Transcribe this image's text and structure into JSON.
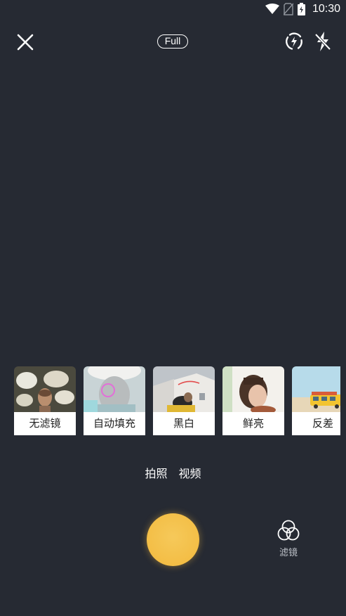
{
  "status_bar": {
    "time": "10:30",
    "icons": [
      "wifi-icon",
      "no-sim-icon",
      "battery-icon"
    ]
  },
  "toolbar": {
    "close_icon": "close-icon",
    "aspect_label": "Full",
    "switch_camera_icon": "switch-camera-icon",
    "flash_icon": "flash-off-icon"
  },
  "filters": [
    {
      "label": "无滤镜"
    },
    {
      "label": "自动填充"
    },
    {
      "label": "黑白"
    },
    {
      "label": "鲜亮"
    },
    {
      "label": "反差"
    }
  ],
  "modes": [
    {
      "label": "拍照"
    },
    {
      "label": "视频"
    }
  ],
  "filter_toggle": {
    "icon": "filter-circles-icon",
    "label": "滤镜"
  },
  "colors": {
    "background": "#262a33",
    "shutter": "#f2b93d",
    "label_bg": "#ffffff"
  }
}
